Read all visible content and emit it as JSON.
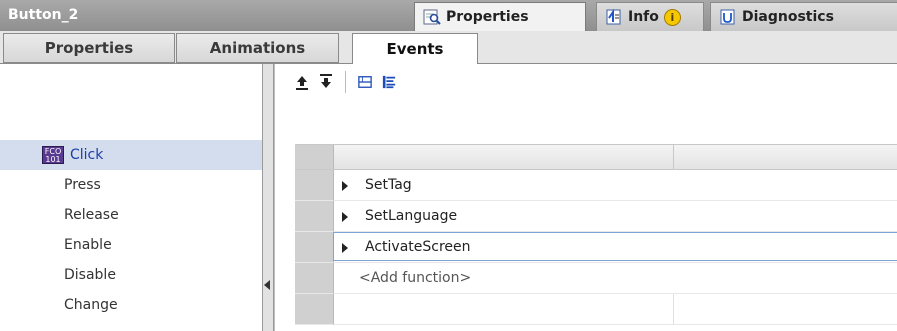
{
  "window": {
    "title": "Button_2"
  },
  "panel_tabs": [
    {
      "label": "Properties",
      "icon": "properties-magnifier-icon",
      "active": true
    },
    {
      "label": "Info",
      "icon": "info-icon",
      "badge": "i"
    },
    {
      "label": "Diagnostics",
      "icon": "diagnostics-icon"
    }
  ],
  "tabs": [
    {
      "label": "Properties"
    },
    {
      "label": "Animations"
    },
    {
      "label": "Events",
      "active": true
    }
  ],
  "events": [
    {
      "label": "Click",
      "selected": true,
      "icon": "click-event-icon"
    },
    {
      "label": "Press"
    },
    {
      "label": "Release"
    },
    {
      "label": "Enable"
    },
    {
      "label": "Disable"
    },
    {
      "label": "Change"
    }
  ],
  "toolbar": {
    "buttons": [
      "move-up-icon",
      "move-down-icon",
      "collapse-all-icon",
      "expand-all-icon"
    ]
  },
  "functions": [
    {
      "label": "SetTag"
    },
    {
      "label": "SetLanguage"
    },
    {
      "label": "ActivateScreen",
      "active": true
    }
  ],
  "add_function": "<Add function>",
  "colors": {
    "selection": "#d4ddee",
    "accent": "#1b3fa8",
    "titlebar": "#9c9c9c"
  }
}
